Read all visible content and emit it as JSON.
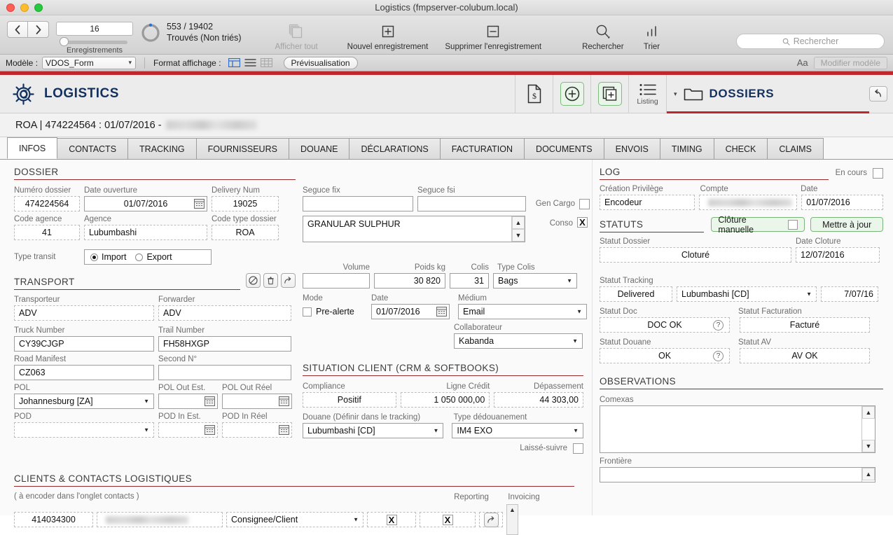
{
  "window": {
    "title": "Logistics (fmpserver-colubum.local)"
  },
  "toolbar": {
    "record_number": "16",
    "records_label": "Enregistrements",
    "found_count": "553 / 19402",
    "found_label": "Trouvés (Non triés)",
    "show_all": "Afficher tout",
    "new_record": "Nouvel enregistrement",
    "delete_record": "Supprimer l'enregistrement",
    "find": "Rechercher",
    "sort": "Trier",
    "search_placeholder": "Rechercher"
  },
  "layoutbar": {
    "model_label": "Modèle :",
    "model_value": "VDOS_Form",
    "view_label": "Format affichage :",
    "preview": "Prévisualisation",
    "text_size_icon": "Aa",
    "edit_layout": "Modifier modèle"
  },
  "appbar": {
    "brand": "LOGISTICS",
    "listing_label": "Listing",
    "module_title": "DOSSIERS"
  },
  "record": {
    "prefix": "ROA | 474224564 : 01/07/2016 -"
  },
  "tabs": [
    {
      "label": "INFOS",
      "active": true
    },
    {
      "label": "CONTACTS",
      "active": false
    },
    {
      "label": "TRACKING",
      "active": false
    },
    {
      "label": "FOURNISSEURS",
      "active": false
    },
    {
      "label": "DOUANE",
      "active": false
    },
    {
      "label": "DÉCLARATIONS",
      "active": false
    },
    {
      "label": "FACTURATION",
      "active": false
    },
    {
      "label": "DOCUMENTS",
      "active": false
    },
    {
      "label": "ENVOIS",
      "active": false
    },
    {
      "label": "TIMING",
      "active": false
    },
    {
      "label": "CHECK",
      "active": false
    },
    {
      "label": "CLAIMS",
      "active": false
    }
  ],
  "dossier": {
    "title": "DOSSIER",
    "numero_label": "Numéro dossier",
    "numero_value": "474224564",
    "date_ouverture_label": "Date ouverture",
    "date_ouverture_value": "01/07/2016",
    "delivery_num_label": "Delivery Num",
    "delivery_num_value": "19025",
    "code_agence_label": "Code agence",
    "code_agence_value": "41",
    "agence_label": "Agence",
    "agence_value": "Lubumbashi",
    "code_type_label": "Code type dossier",
    "code_type_value": "ROA",
    "type_transit_label": "Type transit",
    "import_label": "Import",
    "export_label": "Export",
    "seguce_fix_label": "Seguce fix",
    "seguce_fix_value": "",
    "seguce_fsi_label": "Seguce fsi",
    "seguce_fsi_value": "",
    "gen_cargo_label": "Gen Cargo",
    "gen_cargo_checked": "",
    "conso_label": "Conso",
    "conso_checked": "X",
    "cargo_desc": "GRANULAR SULPHUR"
  },
  "transport": {
    "title": "TRANSPORT",
    "transporteur_label": "Transporteur",
    "transporteur_value": "ADV",
    "forwarder_label": "Forwarder",
    "forwarder_value": "ADV",
    "truck_label": "Truck Number",
    "truck_value": "CY39CJGP",
    "trail_label": "Trail Number",
    "trail_value": "FH58HXGP",
    "manifest_label": "Road Manifest",
    "manifest_value": "CZ063",
    "second_label": "Second N°",
    "second_value": "",
    "pol_label": "POL",
    "pol_value": "Johannesburg [ZA]",
    "pol_out_est_label": "POL Out Est.",
    "pol_out_est_value": "",
    "pol_out_reel_label": "POL Out Réel",
    "pol_out_reel_value": "",
    "pod_label": "POD",
    "pod_value": "",
    "pod_in_est_label": "POD In Est.",
    "pod_in_est_value": "",
    "pod_in_reel_label": "POD In Réel",
    "pod_in_reel_value": ""
  },
  "cargo": {
    "volume_label": "Volume",
    "volume_value": "",
    "poids_label": "Poids kg",
    "poids_value": "30 820",
    "colis_label": "Colis",
    "colis_value": "31",
    "type_colis_label": "Type Colis",
    "type_colis_value": "Bags",
    "mode_label": "Mode",
    "prealerte_label": "Pre-alerte",
    "date_label": "Date",
    "date_value": "01/07/2016",
    "medium_label": "Médium",
    "medium_value": "Email",
    "collaborateur_label": "Collaborateur",
    "collaborateur_value": "Kabanda"
  },
  "situation": {
    "title": "SITUATION CLIENT (CRM & SOFTBOOKS)",
    "compliance_label": "Compliance",
    "compliance_value": "Positif",
    "ligne_credit_label": "Ligne Crédit",
    "ligne_credit_value": "1 050 000,00",
    "depassement_label": "Dépassement",
    "depassement_value": "44 303,00",
    "douane_label": "Douane (Définir dans le tracking)",
    "douane_value": "Lubumbashi [CD]",
    "dedouanement_label": "Type dédouanement",
    "dedouanement_value": "IM4 EXO",
    "laisse_suivre_label": "Laissé-suivre",
    "laisse_suivre_checked": ""
  },
  "clients": {
    "title": "CLIENTS & CONTACTS LOGISTIQUES",
    "note": "( à encoder dans l'onglet contacts )",
    "reporting_label": "Reporting",
    "invoicing_label": "Invoicing",
    "rows": [
      {
        "code": "414034300",
        "name": "",
        "role": "Consignee/Client",
        "reporting": "X",
        "invoicing": "X"
      }
    ]
  },
  "log": {
    "title": "LOG",
    "en_cours_label": "En cours",
    "en_cours_checked": "",
    "creation_label": "Création Privilège",
    "creation_value": "Encodeur",
    "compte_label": "Compte",
    "compte_value": "",
    "date_label": "Date",
    "date_value": "01/07/2016"
  },
  "statuts": {
    "title": "STATUTS",
    "cloture_manuelle_label": "Clôture manuelle",
    "cloture_manuelle_checked": "",
    "mettre_a_jour_label": "Mettre à jour",
    "statut_dossier_label": "Statut Dossier",
    "statut_dossier_value": "Cloturé",
    "date_cloture_label": "Date Cloture",
    "date_cloture_value": "12/07/2016",
    "statut_tracking_label": "Statut Tracking",
    "statut_tracking_value": "Delivered",
    "statut_tracking_place": "Lubumbashi [CD]",
    "statut_tracking_date": "7/07/16",
    "statut_doc_label": "Statut Doc",
    "statut_doc_value": "DOC OK",
    "statut_facturation_label": "Statut Facturation",
    "statut_facturation_value": "Facturé",
    "statut_douane_label": "Statut Douane",
    "statut_douane_value": "OK",
    "statut_av_label": "Statut AV",
    "statut_av_value": "AV OK"
  },
  "observations": {
    "title": "OBSERVATIONS",
    "comexas_label": "Comexas",
    "comexas_value": "",
    "frontiere_label": "Frontière",
    "frontiere_value": ""
  },
  "colors": {
    "accent_red": "#bf272d",
    "brand_navy": "#14315e",
    "green": "#79b579"
  }
}
